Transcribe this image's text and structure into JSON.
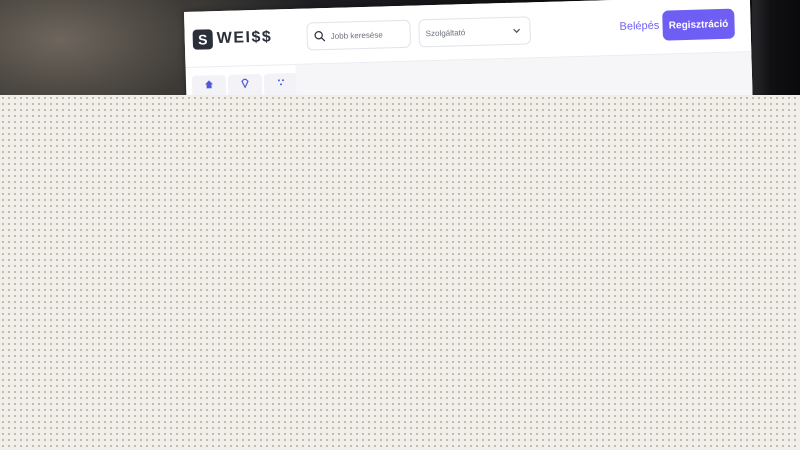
{
  "header": {
    "logo_mark": "S",
    "logo_text": "WEI$$",
    "search": {
      "placeholder": "Jobb keresése"
    },
    "service_select": {
      "value": "Szolgáltató"
    },
    "login_label": "Belépés",
    "register_label": "Regisztráció"
  },
  "categories": [
    {
      "icon": "home-icon"
    },
    {
      "icon": "gem-icon"
    },
    {
      "icon": "sparkle-icon"
    }
  ],
  "colors": {
    "accent": "#6f5ef4",
    "logo": "#2b2f3a",
    "overlay": "#f2efea"
  }
}
